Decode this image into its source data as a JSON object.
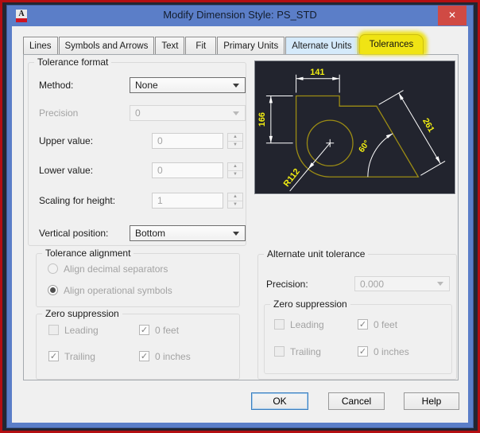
{
  "window": {
    "title": "Modify Dimension Style: PS_STD",
    "app_icon_letter": "A",
    "close_glyph": "✕"
  },
  "tabs": [
    {
      "label": "Lines",
      "active": false
    },
    {
      "label": "Symbols and Arrows",
      "active": false
    },
    {
      "label": "Text",
      "active": false
    },
    {
      "label": "Fit",
      "active": false
    },
    {
      "label": "Primary Units",
      "active": false
    },
    {
      "label": "Alternate Units",
      "active": false
    },
    {
      "label": "Tolerances",
      "active": true,
      "highlighted_yellow": true
    }
  ],
  "tolerance_format": {
    "legend": "Tolerance format",
    "method": {
      "label": "Method:",
      "value": "None",
      "enabled": true
    },
    "precision": {
      "label": "Precision",
      "value": "0",
      "enabled": false
    },
    "upper_value": {
      "label": "Upper value:",
      "value": "0",
      "enabled": false
    },
    "lower_value": {
      "label": "Lower value:",
      "value": "0",
      "enabled": false
    },
    "scaling_for_height": {
      "label": "Scaling for height:",
      "value": "1",
      "enabled": false
    },
    "vertical_position": {
      "label": "Vertical position:",
      "value": "Bottom",
      "enabled": true
    }
  },
  "tolerance_alignment": {
    "legend": "Tolerance alignment",
    "options": [
      {
        "label": "Align decimal separators",
        "selected": false,
        "enabled": false
      },
      {
        "label": "Align operational symbols",
        "selected": true,
        "enabled": false
      }
    ]
  },
  "zero_suppression": {
    "legend": "Zero suppression",
    "items": [
      {
        "label": "Leading",
        "checked": false,
        "enabled": false
      },
      {
        "label": "0 feet",
        "checked": true,
        "enabled": false
      },
      {
        "label": "Trailing",
        "checked": true,
        "enabled": false
      },
      {
        "label": "0 inches",
        "checked": true,
        "enabled": false
      }
    ]
  },
  "alternate_unit_tolerance": {
    "legend": "Alternate unit tolerance",
    "precision": {
      "label": "Precision:",
      "value": "0.000",
      "enabled": false
    },
    "zero_suppression": {
      "legend": "Zero suppression",
      "items": [
        {
          "label": "Leading",
          "checked": false,
          "enabled": false
        },
        {
          "label": "0 feet",
          "checked": true,
          "enabled": false
        },
        {
          "label": "Trailing",
          "checked": false,
          "enabled": false
        },
        {
          "label": "0 inches",
          "checked": true,
          "enabled": false
        }
      ]
    }
  },
  "preview": {
    "dim_top": "141",
    "dim_left": "166",
    "dim_diagonal": "261",
    "dim_angle": "60°",
    "dim_radius": "R112",
    "colors": {
      "background": "#22242e",
      "shape": "#9c8c14",
      "dim_line": "#ffffff",
      "dim_text": "#f2ee12"
    }
  },
  "buttons": {
    "ok": "OK",
    "cancel": "Cancel",
    "help": "Help"
  },
  "glyphs": {
    "check": "✓",
    "spin_up": "▲",
    "spin_down": "▼"
  },
  "icons": {
    "chevron_down": "css-triangle",
    "close": "✕",
    "check": "✓",
    "autocad_logo": "A"
  }
}
